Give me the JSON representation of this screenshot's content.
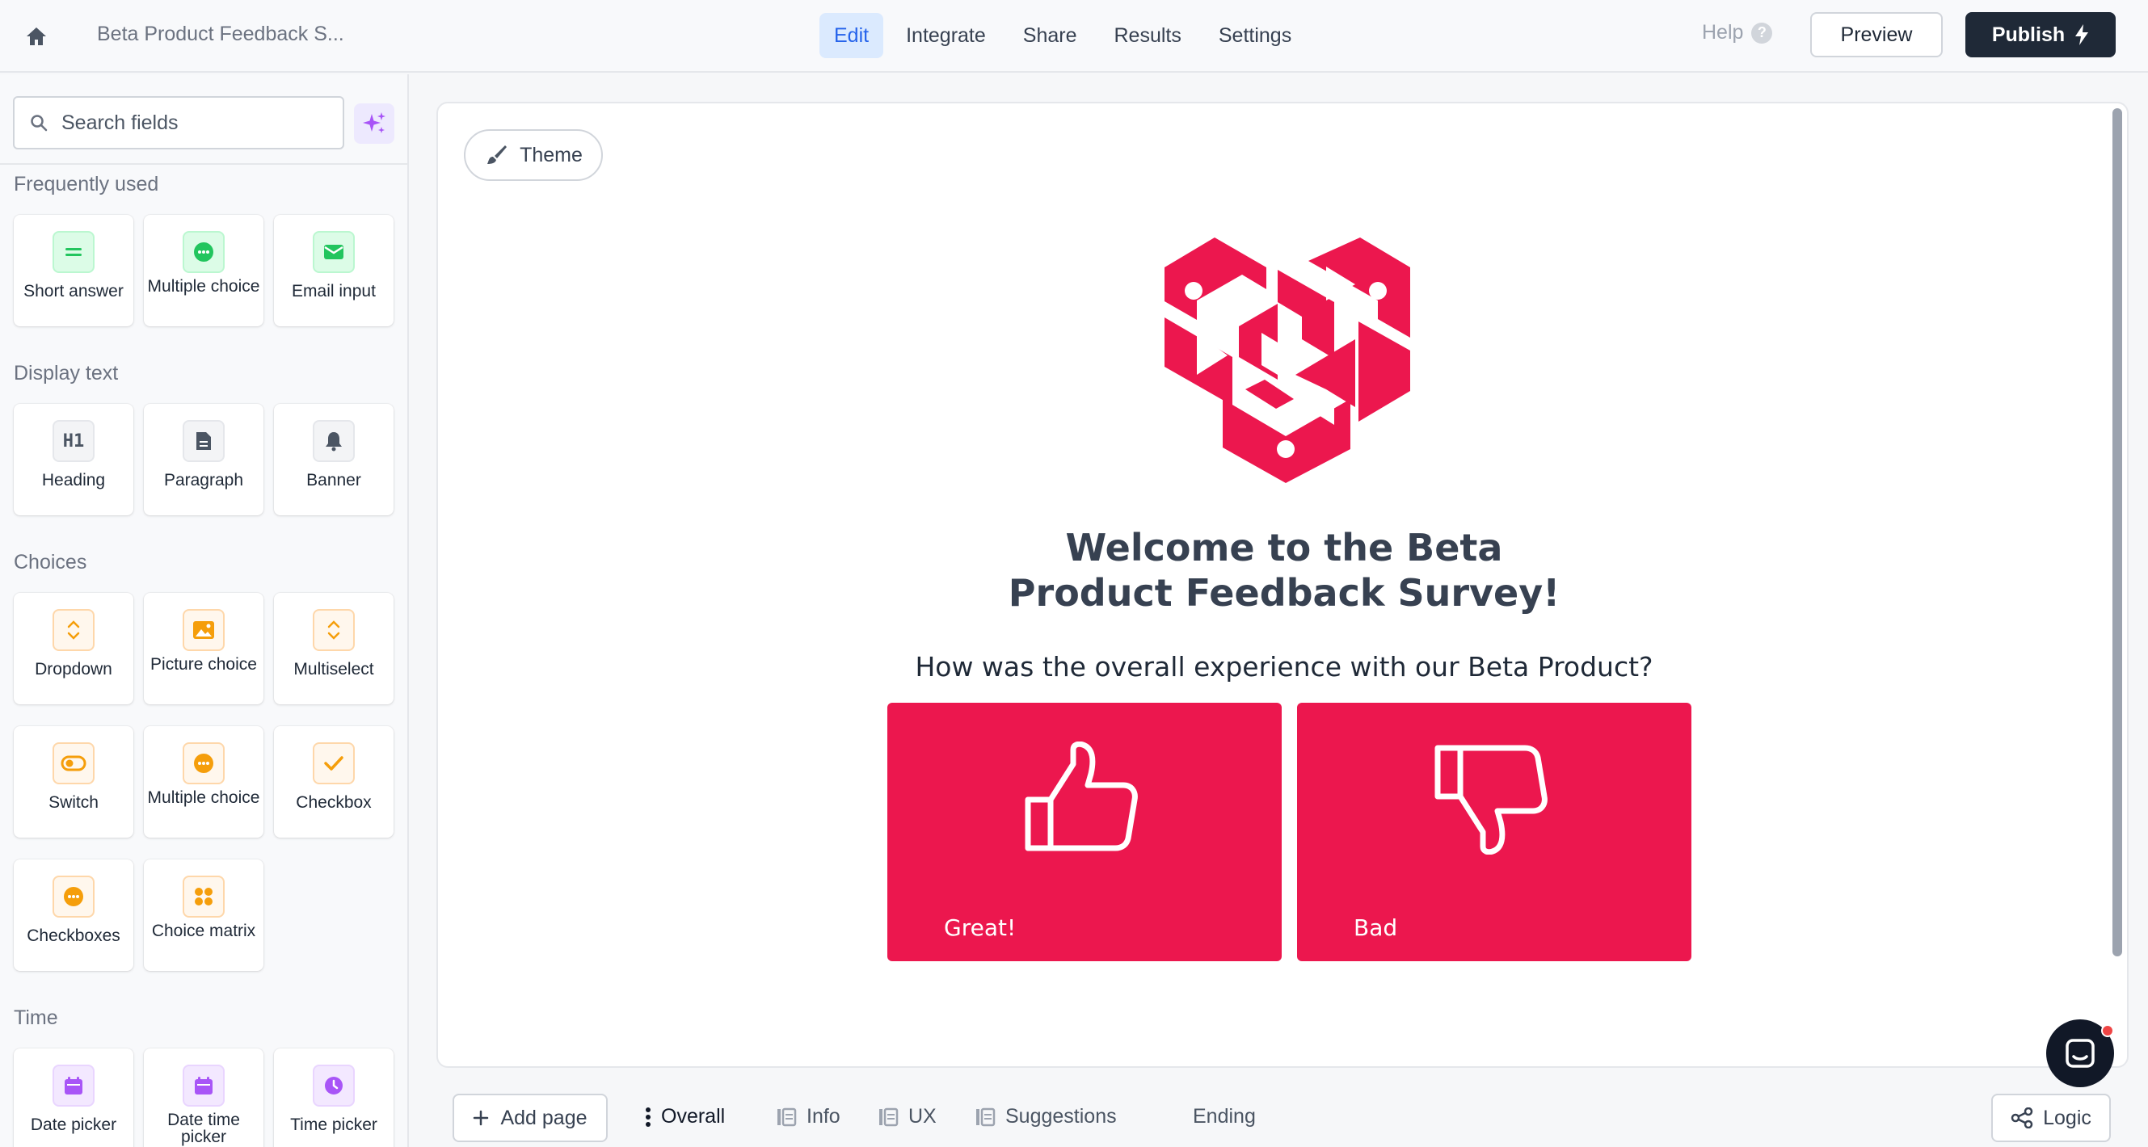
{
  "header": {
    "form_title": "Beta Product Feedback S...",
    "tabs": [
      {
        "label": "Edit",
        "active": true
      },
      {
        "label": "Integrate",
        "active": false
      },
      {
        "label": "Share",
        "active": false
      },
      {
        "label": "Results",
        "active": false
      },
      {
        "label": "Settings",
        "active": false
      }
    ],
    "help_label": "Help",
    "help_icon": "?",
    "preview_label": "Preview",
    "publish_label": "Publish"
  },
  "sidebar": {
    "search_placeholder": "Search fields",
    "sections": {
      "frequently_used": "Frequently used",
      "display_text": "Display text",
      "choices": "Choices",
      "time": "Time"
    },
    "fields": {
      "short_answer": "Short answer",
      "multiple_choice": "Multiple choice",
      "email_input": "Email input",
      "heading": "Heading",
      "heading_icon": "H1",
      "paragraph": "Paragraph",
      "banner": "Banner",
      "dropdown": "Dropdown",
      "picture_choice": "Picture choice",
      "multiselect": "Multiselect",
      "switch": "Switch",
      "multiple_choice_2": "Multiple choice",
      "checkbox": "Checkbox",
      "checkboxes": "Checkboxes",
      "choice_matrix": "Choice matrix",
      "date_picker": "Date picker",
      "date_time_picker": "Date time picker",
      "time_picker": "Time picker"
    }
  },
  "canvas": {
    "theme_label": "Theme",
    "welcome_title": "Welcome to the Beta Product Feedback Survey!",
    "question": "How was the overall experience with our Beta Product?",
    "choices": [
      {
        "label": "Great!",
        "icon": "thumbs-up-icon"
      },
      {
        "label": "Bad",
        "icon": "thumbs-down-icon"
      }
    ],
    "accent_color": "#ec174e"
  },
  "bottom_bar": {
    "add_page_label": "Add page",
    "pages": [
      {
        "label": "Overall",
        "active": true
      },
      {
        "label": "Info",
        "active": false
      },
      {
        "label": "UX",
        "active": false
      },
      {
        "label": "Suggestions",
        "active": false
      },
      {
        "label": "Ending",
        "active": false
      }
    ],
    "logic_label": "Logic"
  },
  "colors": {
    "primary_dark": "#1f2937",
    "edit_tab_blue": "#2563eb",
    "brand_pink": "#ec174e"
  }
}
